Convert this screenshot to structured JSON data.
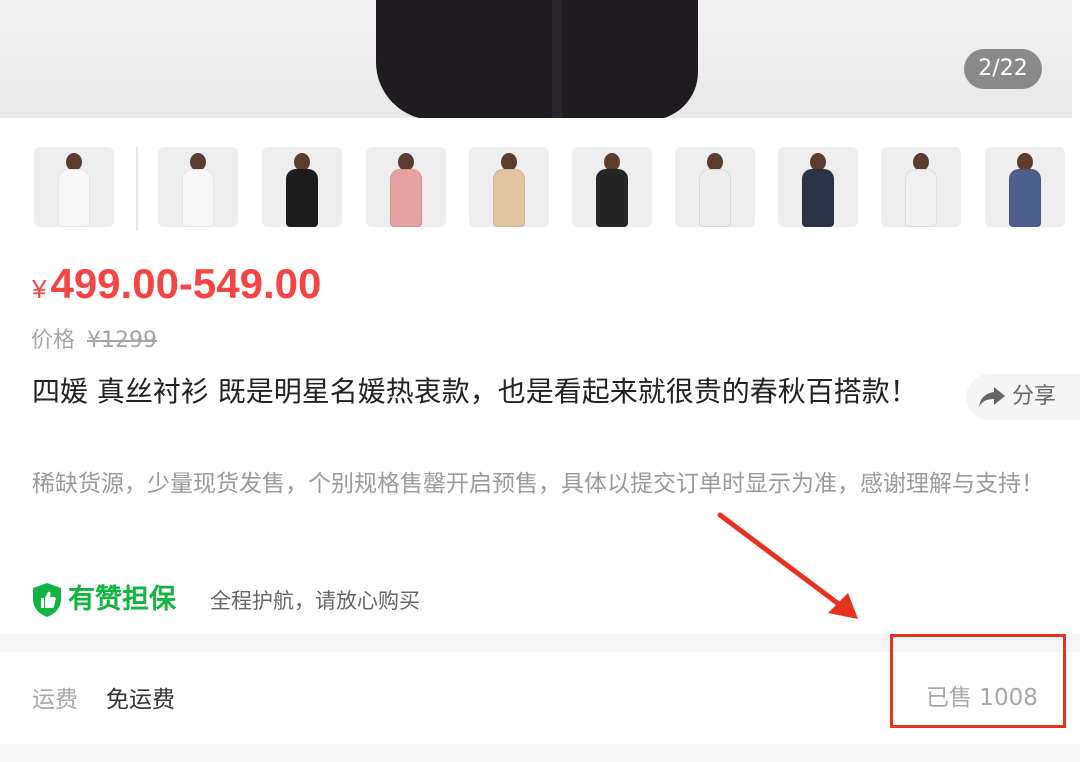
{
  "gallery": {
    "counter": "2/22",
    "thumbnails": [
      {
        "name": "white-shirt",
        "shirt_color": "#f7f7f7"
      },
      {
        "name": "white-shirt-2",
        "shirt_color": "#f7f7f7"
      },
      {
        "name": "black-shirt",
        "shirt_color": "#1c1c1c"
      },
      {
        "name": "pink-shirt",
        "shirt_color": "#e7a3a4"
      },
      {
        "name": "beige-shirt",
        "shirt_color": "#e2c3a2"
      },
      {
        "name": "black-polka-shirt",
        "shirt_color": "#262626"
      },
      {
        "name": "white-polka-shirt",
        "shirt_color": "#ececec"
      },
      {
        "name": "navy-print-shirt",
        "shirt_color": "#2b3347"
      },
      {
        "name": "white-print-shirt",
        "shirt_color": "#f1f1f1"
      },
      {
        "name": "blue-print-shirt",
        "shirt_color": "#4d5f8e"
      }
    ]
  },
  "price": {
    "currency": "¥",
    "range": "499.00-549.00",
    "label": "价格",
    "original": "¥1299"
  },
  "product": {
    "title": "四媛 真丝衬衫 既是明星名媛热衷款，也是看起来就很贵的春秋百搭款！",
    "description": "稀缺货源，少量现货发售，个别规格售罄开启预售，具体以提交订单时显示为准，感谢理解与支持！"
  },
  "share": {
    "label": "分享"
  },
  "guarantee": {
    "title": "有赞担保",
    "desc": "全程护航，请放心购买",
    "color": "#12b341"
  },
  "shipping": {
    "label": "运费",
    "value": "免运费",
    "sold": "已售 1008"
  },
  "accent_color": "#f44444",
  "annotation_color": "#e6321e"
}
